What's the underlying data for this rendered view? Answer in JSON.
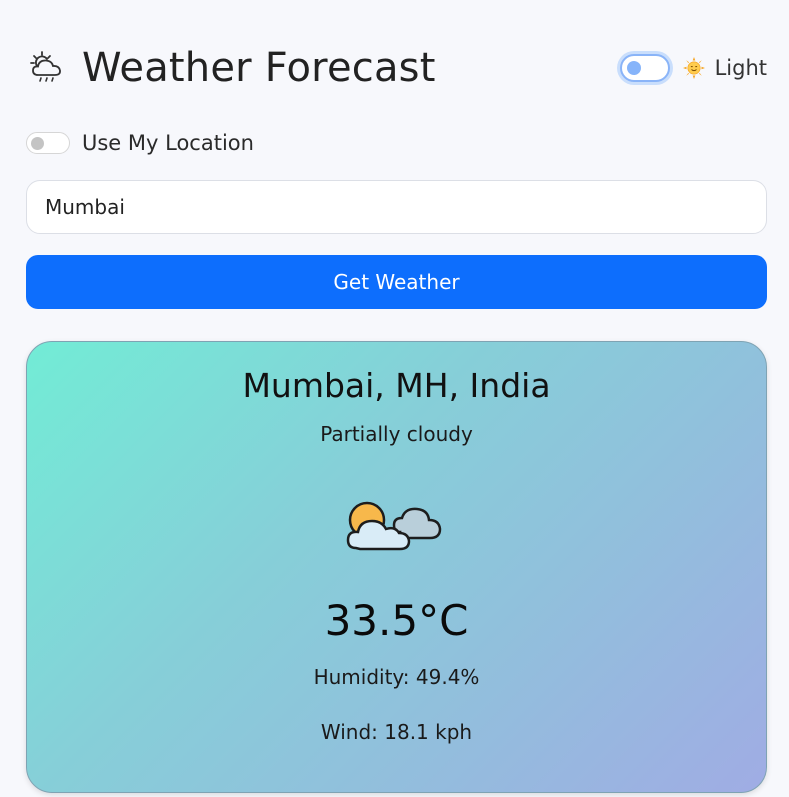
{
  "header": {
    "title": "Weather Forecast",
    "title_icon": "cloud-rain-sun-icon",
    "theme_toggle": {
      "label": "Light",
      "emoji_icon": "sun-face-icon",
      "state": "off"
    }
  },
  "location_toggle": {
    "label": "Use My Location",
    "state": "off"
  },
  "search": {
    "value": "Mumbai",
    "placeholder": ""
  },
  "actions": {
    "get_weather_label": "Get Weather"
  },
  "weather_card": {
    "location": "Mumbai, MH, India",
    "condition": "Partially cloudy",
    "icon": "partly-cloudy-icon",
    "temperature": "33.5°C",
    "humidity": "Humidity: 49.4%",
    "wind": "Wind: 18.1 kph"
  },
  "colors": {
    "accent": "#0d6efd",
    "background": "#f7f8fc",
    "card_gradient_start": "#72ecd6",
    "card_gradient_end": "#a0ace4"
  }
}
